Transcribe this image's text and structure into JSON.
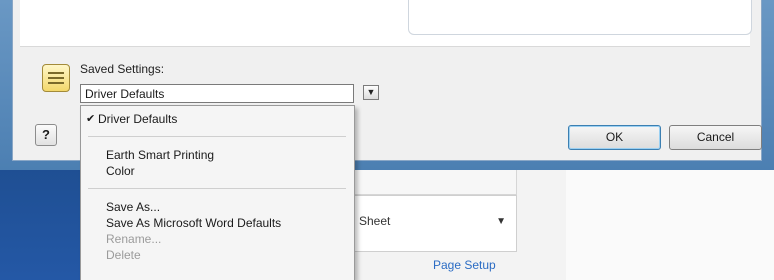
{
  "dialog": {
    "saved_settings_label": "Saved Settings:",
    "combo_value": "Driver Defaults",
    "help_label": "?",
    "ok_label": "OK",
    "cancel_label": "Cancel"
  },
  "menu": {
    "items": [
      {
        "label": "Driver Defaults",
        "checked": true,
        "enabled": true
      },
      {
        "label": "Earth Smart Printing",
        "enabled": true
      },
      {
        "label": "Color",
        "enabled": true
      },
      {
        "label": "Save As...",
        "enabled": true
      },
      {
        "label": "Save As Microsoft Word Defaults",
        "enabled": true
      },
      {
        "label": "Rename...",
        "enabled": false
      },
      {
        "label": "Delete",
        "enabled": false
      }
    ]
  },
  "background": {
    "field_text": "Sheet",
    "link_text": "Page Setup"
  },
  "icons": [
    "settings-icon",
    "checkmark-icon",
    "dropdown-arrow-icon"
  ],
  "colors": {
    "title_bar": "#5a8cbd",
    "menu_bg": "#f5f5f5",
    "link": "#2b6cc4"
  }
}
